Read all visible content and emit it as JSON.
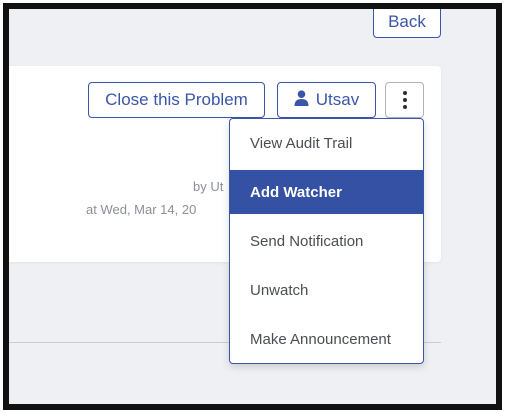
{
  "header": {
    "back_label": "Back"
  },
  "toolbar": {
    "close_label": "Close this Problem",
    "user_label": "Utsav",
    "more_icon": "kebab-vertical-icon",
    "user_icon": "user-icon"
  },
  "meta": {
    "by_text": "by Ut",
    "at_text": "at Wed, Mar 14, 20"
  },
  "menu": {
    "items": [
      {
        "label": "View Audit Trail",
        "active": false
      },
      {
        "label": "Add Watcher",
        "active": true
      },
      {
        "label": "Send Notification",
        "active": false
      },
      {
        "label": "Unwatch",
        "active": false
      },
      {
        "label": "Make Announcement",
        "active": false
      }
    ]
  },
  "colors": {
    "accent": "#3a56a8",
    "active_bg": "#3551a3",
    "page_bg": "#eef0f4"
  }
}
